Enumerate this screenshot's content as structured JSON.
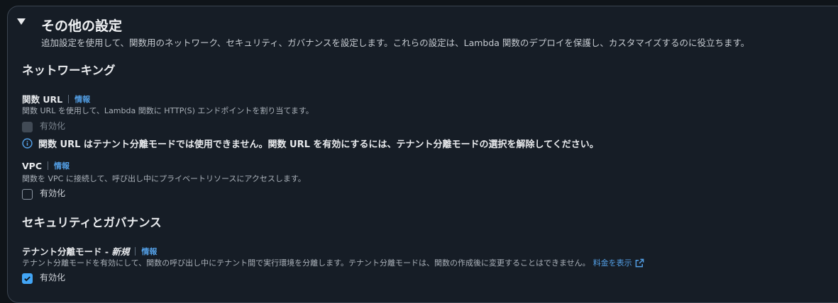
{
  "section": {
    "title": "その他の設定",
    "description": "追加設定を使用して、関数用のネットワーク、セキュリティ、ガバナンスを設定します。これらの設定は、Lambda 関数のデプロイを保護し、カスタマイズするのに役立ちます。"
  },
  "networking": {
    "heading": "ネットワーキング",
    "function_url": {
      "label": "関数 URL",
      "info": "情報",
      "description": "関数 URL を使用して、Lambda 関数に HTTP(S) エンドポイントを割り当てます。",
      "checkbox_label": "有効化",
      "checked": false,
      "disabled": true,
      "notice": "関数 URL はテナント分離モードでは使用できません。関数 URL を有効にするには、テナント分離モードの選択を解除してください。"
    },
    "vpc": {
      "label": "VPC",
      "info": "情報",
      "description": "関数を VPC に接続して、呼び出し中にプライベートリソースにアクセスします。",
      "checkbox_label": "有効化",
      "checked": false
    }
  },
  "security": {
    "heading": "セキュリティとガバナンス",
    "tenant_isolation": {
      "label": "テナント分離モード - ",
      "label_new": "新規",
      "info": "情報",
      "description": "テナント分離モードを有効にして、関数の呼び出し中にテナント間で実行環境を分離します。テナント分離モードは、関数の作成後に変更することはできません。",
      "pricing_link": "料金を表示",
      "checkbox_label": "有効化",
      "checked": true
    }
  },
  "colors": {
    "background": "#0f1419",
    "panel": "#161d26",
    "link": "#539fe5",
    "checkbox_checked": "#42a5f5"
  }
}
